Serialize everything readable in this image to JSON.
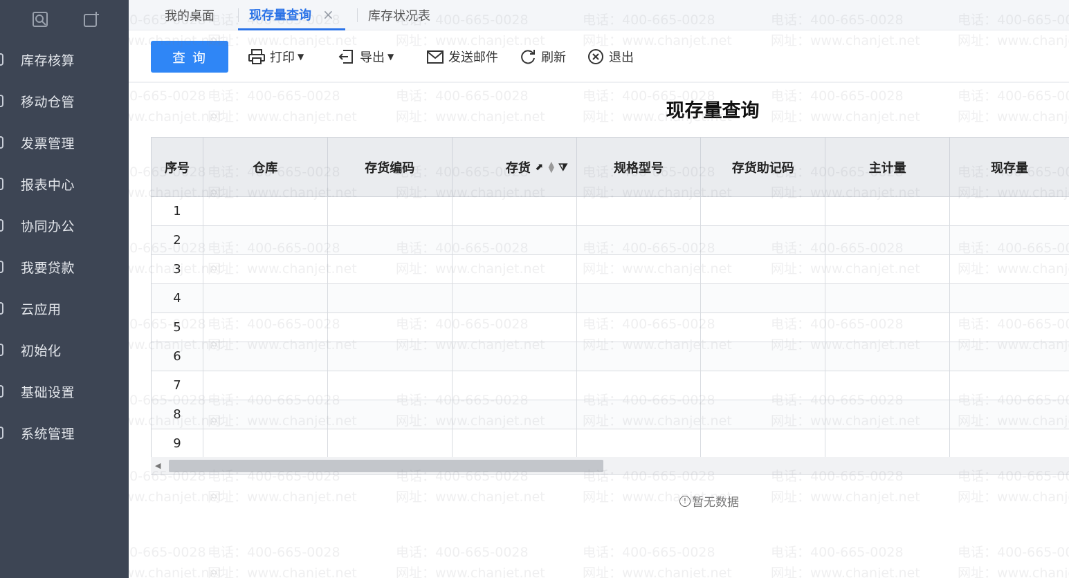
{
  "sidebar": {
    "items": [
      {
        "label": "库存核算"
      },
      {
        "label": "移动仓管"
      },
      {
        "label": "发票管理"
      },
      {
        "label": "报表中心"
      },
      {
        "label": "协同办公"
      },
      {
        "label": "我要贷款"
      },
      {
        "label": "云应用"
      },
      {
        "label": "初始化"
      },
      {
        "label": "基础设置"
      },
      {
        "label": "系统管理"
      }
    ]
  },
  "tabs": [
    {
      "label": "我的桌面",
      "active": false
    },
    {
      "label": "现存量查询",
      "active": true,
      "close": "×"
    },
    {
      "label": "库存状况表",
      "active": false
    }
  ],
  "toolbar": {
    "query_label": "查 询",
    "print_label": "打印",
    "export_label": "导出",
    "email_label": "发送邮件",
    "refresh_label": "刷新",
    "exit_label": "退出"
  },
  "report": {
    "title": "现存量查询",
    "columns": [
      "序号",
      "仓库",
      "存货编码",
      "存货",
      "规格型号",
      "存货助记码",
      "主计量",
      "现存量"
    ],
    "rows": [
      "1",
      "2",
      "3",
      "4",
      "5",
      "6",
      "7",
      "8",
      "9"
    ],
    "empty_text": "暂无数据"
  },
  "watermark": {
    "line1": "电话：400-665-0028",
    "line2": "网址：www.chanjet.net"
  },
  "colors": {
    "sidebar_bg": "#3d4554",
    "accent": "#2a73e8",
    "query_button": "#2f86f6"
  }
}
